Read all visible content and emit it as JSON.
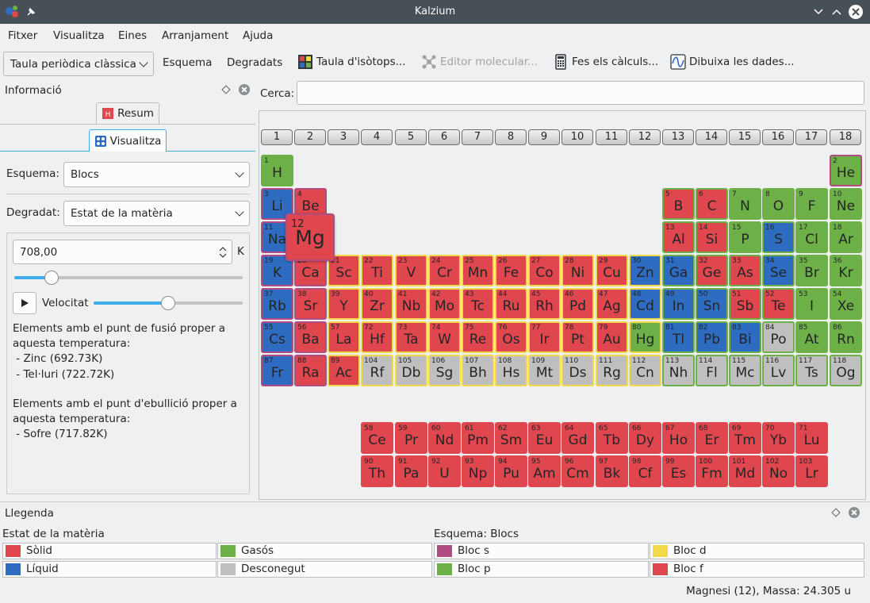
{
  "window": {
    "title": "Kalzium"
  },
  "menu": [
    "Fitxer",
    "Visualitza",
    "Eines",
    "Arranjament",
    "Ajuda"
  ],
  "toolbar": {
    "table_select": "Taula periòdica clàssica",
    "scheme": "Esquema",
    "gradients": "Degradats",
    "isotopes": "Taula d'isòtops...",
    "molecular_editor": "Editor molecular...",
    "calculations": "Fes els càlculs...",
    "plot_data": "Dibuixa les dades..."
  },
  "info_panel": {
    "title": "Informació",
    "tab_summary": "Resum",
    "tab_view": "Visualitza",
    "scheme_label": "Esquema:",
    "scheme_value": "Blocs",
    "gradient_label": "Degradat:",
    "gradient_value": "Estat de la matèria",
    "temperature_value": "708,00",
    "temperature_unit": "K",
    "temperature_slider_fraction": 0.14,
    "speed_label": "Velocitat",
    "speed_slider_fraction": 0.5,
    "melting_text": [
      "Elements amb el punt de fusió proper a",
      "aquesta temperatura:",
      " - Zinc (692.73K)",
      " - Tel·luri (722.72K)"
    ],
    "boiling_text": [
      "Elements amb el punt d'ebullició proper a",
      "aquesta temperatura:",
      " - Sofre (717.82K)"
    ]
  },
  "search": {
    "label": "Cerca:",
    "value": ""
  },
  "groups": [
    "1",
    "2",
    "3",
    "4",
    "5",
    "6",
    "7",
    "8",
    "9",
    "10",
    "11",
    "12",
    "13",
    "14",
    "15",
    "16",
    "17",
    "18"
  ],
  "colors": {
    "solid": "#e0464d",
    "liquid": "#2d6cc0",
    "gas": "#6eb048",
    "unknown": "#bfbfbf",
    "block_s": "#b24b82",
    "block_p": "#6eb048",
    "block_d": "#f1d94a",
    "block_f": "#e0464d"
  },
  "elements": [
    {
      "sym": "H",
      "num": 1,
      "p": 1,
      "g": 1,
      "st": "gas",
      "b": "p"
    },
    {
      "sym": "He",
      "num": 2,
      "p": 1,
      "g": 18,
      "st": "gas",
      "b": "s"
    },
    {
      "sym": "Li",
      "num": 3,
      "p": 2,
      "g": 1,
      "st": "liquid",
      "b": "s"
    },
    {
      "sym": "Be",
      "num": 4,
      "p": 2,
      "g": 2,
      "st": "solid",
      "b": "s"
    },
    {
      "sym": "B",
      "num": 5,
      "p": 2,
      "g": 13,
      "st": "solid",
      "b": "p"
    },
    {
      "sym": "C",
      "num": 6,
      "p": 2,
      "g": 14,
      "st": "solid",
      "b": "p"
    },
    {
      "sym": "N",
      "num": 7,
      "p": 2,
      "g": 15,
      "st": "gas",
      "b": "p"
    },
    {
      "sym": "O",
      "num": 8,
      "p": 2,
      "g": 16,
      "st": "gas",
      "b": "p"
    },
    {
      "sym": "F",
      "num": 9,
      "p": 2,
      "g": 17,
      "st": "gas",
      "b": "p"
    },
    {
      "sym": "Ne",
      "num": 10,
      "p": 2,
      "g": 18,
      "st": "gas",
      "b": "p"
    },
    {
      "sym": "Na",
      "num": 11,
      "p": 3,
      "g": 1,
      "st": "liquid",
      "b": "s"
    },
    {
      "sym": "Al",
      "num": 13,
      "p": 3,
      "g": 13,
      "st": "solid",
      "b": "p"
    },
    {
      "sym": "Si",
      "num": 14,
      "p": 3,
      "g": 14,
      "st": "solid",
      "b": "p"
    },
    {
      "sym": "P",
      "num": 15,
      "p": 3,
      "g": 15,
      "st": "gas",
      "b": "p"
    },
    {
      "sym": "S",
      "num": 16,
      "p": 3,
      "g": 16,
      "st": "liquid",
      "b": "p"
    },
    {
      "sym": "Cl",
      "num": 17,
      "p": 3,
      "g": 17,
      "st": "gas",
      "b": "p"
    },
    {
      "sym": "Ar",
      "num": 18,
      "p": 3,
      "g": 18,
      "st": "gas",
      "b": "p"
    },
    {
      "sym": "K",
      "num": 19,
      "p": 4,
      "g": 1,
      "st": "liquid",
      "b": "s"
    },
    {
      "sym": "Ca",
      "num": 20,
      "p": 4,
      "g": 2,
      "st": "solid",
      "b": "s"
    },
    {
      "sym": "Sc",
      "num": 21,
      "p": 4,
      "g": 3,
      "st": "solid",
      "b": "d"
    },
    {
      "sym": "Ti",
      "num": 22,
      "p": 4,
      "g": 4,
      "st": "solid",
      "b": "d"
    },
    {
      "sym": "V",
      "num": 23,
      "p": 4,
      "g": 5,
      "st": "solid",
      "b": "d"
    },
    {
      "sym": "Cr",
      "num": 24,
      "p": 4,
      "g": 6,
      "st": "solid",
      "b": "d"
    },
    {
      "sym": "Mn",
      "num": 25,
      "p": 4,
      "g": 7,
      "st": "solid",
      "b": "d"
    },
    {
      "sym": "Fe",
      "num": 26,
      "p": 4,
      "g": 8,
      "st": "solid",
      "b": "d"
    },
    {
      "sym": "Co",
      "num": 27,
      "p": 4,
      "g": 9,
      "st": "solid",
      "b": "d"
    },
    {
      "sym": "Ni",
      "num": 28,
      "p": 4,
      "g": 10,
      "st": "solid",
      "b": "d"
    },
    {
      "sym": "Cu",
      "num": 29,
      "p": 4,
      "g": 11,
      "st": "solid",
      "b": "d"
    },
    {
      "sym": "Zn",
      "num": 30,
      "p": 4,
      "g": 12,
      "st": "liquid",
      "b": "d"
    },
    {
      "sym": "Ga",
      "num": 31,
      "p": 4,
      "g": 13,
      "st": "liquid",
      "b": "p"
    },
    {
      "sym": "Ge",
      "num": 32,
      "p": 4,
      "g": 14,
      "st": "solid",
      "b": "p"
    },
    {
      "sym": "As",
      "num": 33,
      "p": 4,
      "g": 15,
      "st": "solid",
      "b": "p"
    },
    {
      "sym": "Se",
      "num": 34,
      "p": 4,
      "g": 16,
      "st": "liquid",
      "b": "p"
    },
    {
      "sym": "Br",
      "num": 35,
      "p": 4,
      "g": 17,
      "st": "gas",
      "b": "p"
    },
    {
      "sym": "Kr",
      "num": 36,
      "p": 4,
      "g": 18,
      "st": "gas",
      "b": "p"
    },
    {
      "sym": "Rb",
      "num": 37,
      "p": 5,
      "g": 1,
      "st": "liquid",
      "b": "s"
    },
    {
      "sym": "Sr",
      "num": 38,
      "p": 5,
      "g": 2,
      "st": "solid",
      "b": "s"
    },
    {
      "sym": "Y",
      "num": 39,
      "p": 5,
      "g": 3,
      "st": "solid",
      "b": "d"
    },
    {
      "sym": "Zr",
      "num": 40,
      "p": 5,
      "g": 4,
      "st": "solid",
      "b": "d"
    },
    {
      "sym": "Nb",
      "num": 41,
      "p": 5,
      "g": 5,
      "st": "solid",
      "b": "d"
    },
    {
      "sym": "Mo",
      "num": 42,
      "p": 5,
      "g": 6,
      "st": "solid",
      "b": "d"
    },
    {
      "sym": "Tc",
      "num": 43,
      "p": 5,
      "g": 7,
      "st": "solid",
      "b": "d"
    },
    {
      "sym": "Ru",
      "num": 44,
      "p": 5,
      "g": 8,
      "st": "solid",
      "b": "d"
    },
    {
      "sym": "Rh",
      "num": 45,
      "p": 5,
      "g": 9,
      "st": "solid",
      "b": "d"
    },
    {
      "sym": "Pd",
      "num": 46,
      "p": 5,
      "g": 10,
      "st": "solid",
      "b": "d"
    },
    {
      "sym": "Ag",
      "num": 47,
      "p": 5,
      "g": 11,
      "st": "solid",
      "b": "d"
    },
    {
      "sym": "Cd",
      "num": 48,
      "p": 5,
      "g": 12,
      "st": "liquid",
      "b": "d"
    },
    {
      "sym": "In",
      "num": 49,
      "p": 5,
      "g": 13,
      "st": "liquid",
      "b": "p"
    },
    {
      "sym": "Sn",
      "num": 50,
      "p": 5,
      "g": 14,
      "st": "liquid",
      "b": "p"
    },
    {
      "sym": "Sb",
      "num": 51,
      "p": 5,
      "g": 15,
      "st": "solid",
      "b": "p"
    },
    {
      "sym": "Te",
      "num": 52,
      "p": 5,
      "g": 16,
      "st": "solid",
      "b": "p"
    },
    {
      "sym": "I",
      "num": 53,
      "p": 5,
      "g": 17,
      "st": "gas",
      "b": "p"
    },
    {
      "sym": "Xe",
      "num": 54,
      "p": 5,
      "g": 18,
      "st": "gas",
      "b": "p"
    },
    {
      "sym": "Cs",
      "num": 55,
      "p": 6,
      "g": 1,
      "st": "liquid",
      "b": "s"
    },
    {
      "sym": "Ba",
      "num": 56,
      "p": 6,
      "g": 2,
      "st": "solid",
      "b": "s"
    },
    {
      "sym": "La",
      "num": 57,
      "p": 6,
      "g": 3,
      "st": "solid",
      "b": "d"
    },
    {
      "sym": "Hf",
      "num": 72,
      "p": 6,
      "g": 4,
      "st": "solid",
      "b": "d"
    },
    {
      "sym": "Ta",
      "num": 73,
      "p": 6,
      "g": 5,
      "st": "solid",
      "b": "d"
    },
    {
      "sym": "W",
      "num": 74,
      "p": 6,
      "g": 6,
      "st": "solid",
      "b": "d"
    },
    {
      "sym": "Re",
      "num": 75,
      "p": 6,
      "g": 7,
      "st": "solid",
      "b": "d"
    },
    {
      "sym": "Os",
      "num": 76,
      "p": 6,
      "g": 8,
      "st": "solid",
      "b": "d"
    },
    {
      "sym": "Ir",
      "num": 77,
      "p": 6,
      "g": 9,
      "st": "solid",
      "b": "d"
    },
    {
      "sym": "Pt",
      "num": 78,
      "p": 6,
      "g": 10,
      "st": "solid",
      "b": "d"
    },
    {
      "sym": "Au",
      "num": 79,
      "p": 6,
      "g": 11,
      "st": "solid",
      "b": "d"
    },
    {
      "sym": "Hg",
      "num": 80,
      "p": 6,
      "g": 12,
      "st": "gas",
      "b": "d"
    },
    {
      "sym": "Tl",
      "num": 81,
      "p": 6,
      "g": 13,
      "st": "liquid",
      "b": "p"
    },
    {
      "sym": "Pb",
      "num": 82,
      "p": 6,
      "g": 14,
      "st": "liquid",
      "b": "p"
    },
    {
      "sym": "Bi",
      "num": 83,
      "p": 6,
      "g": 15,
      "st": "liquid",
      "b": "p"
    },
    {
      "sym": "Po",
      "num": 84,
      "p": 6,
      "g": 16,
      "st": "unknown",
      "b": "p"
    },
    {
      "sym": "At",
      "num": 85,
      "p": 6,
      "g": 17,
      "st": "gas",
      "b": "p"
    },
    {
      "sym": "Rn",
      "num": 86,
      "p": 6,
      "g": 18,
      "st": "gas",
      "b": "p"
    },
    {
      "sym": "Fr",
      "num": 87,
      "p": 7,
      "g": 1,
      "st": "liquid",
      "b": "s"
    },
    {
      "sym": "Ra",
      "num": 88,
      "p": 7,
      "g": 2,
      "st": "solid",
      "b": "s"
    },
    {
      "sym": "Ac",
      "num": 89,
      "p": 7,
      "g": 3,
      "st": "solid",
      "b": "d"
    },
    {
      "sym": "Rf",
      "num": 104,
      "p": 7,
      "g": 4,
      "st": "unknown",
      "b": "d"
    },
    {
      "sym": "Db",
      "num": 105,
      "p": 7,
      "g": 5,
      "st": "unknown",
      "b": "d"
    },
    {
      "sym": "Sg",
      "num": 106,
      "p": 7,
      "g": 6,
      "st": "unknown",
      "b": "d"
    },
    {
      "sym": "Bh",
      "num": 107,
      "p": 7,
      "g": 7,
      "st": "unknown",
      "b": "d"
    },
    {
      "sym": "Hs",
      "num": 108,
      "p": 7,
      "g": 8,
      "st": "unknown",
      "b": "d"
    },
    {
      "sym": "Mt",
      "num": 109,
      "p": 7,
      "g": 9,
      "st": "unknown",
      "b": "d"
    },
    {
      "sym": "Ds",
      "num": 110,
      "p": 7,
      "g": 10,
      "st": "unknown",
      "b": "d"
    },
    {
      "sym": "Rg",
      "num": 111,
      "p": 7,
      "g": 11,
      "st": "unknown",
      "b": "d"
    },
    {
      "sym": "Cn",
      "num": 112,
      "p": 7,
      "g": 12,
      "st": "unknown",
      "b": "d"
    },
    {
      "sym": "Nh",
      "num": 113,
      "p": 7,
      "g": 13,
      "st": "unknown",
      "b": "p"
    },
    {
      "sym": "Fl",
      "num": 114,
      "p": 7,
      "g": 14,
      "st": "unknown",
      "b": "p"
    },
    {
      "sym": "Mc",
      "num": 115,
      "p": 7,
      "g": 15,
      "st": "unknown",
      "b": "p"
    },
    {
      "sym": "Lv",
      "num": 116,
      "p": 7,
      "g": 16,
      "st": "unknown",
      "b": "p"
    },
    {
      "sym": "Ts",
      "num": 117,
      "p": 7,
      "g": 17,
      "st": "unknown",
      "b": "p"
    },
    {
      "sym": "Og",
      "num": 118,
      "p": 7,
      "g": 18,
      "st": "unknown",
      "b": "p"
    },
    {
      "sym": "Ce",
      "num": 58,
      "p": 9,
      "g": 4,
      "st": "solid",
      "b": "f"
    },
    {
      "sym": "Pr",
      "num": 59,
      "p": 9,
      "g": 5,
      "st": "solid",
      "b": "f"
    },
    {
      "sym": "Nd",
      "num": 60,
      "p": 9,
      "g": 6,
      "st": "solid",
      "b": "f"
    },
    {
      "sym": "Pm",
      "num": 61,
      "p": 9,
      "g": 7,
      "st": "solid",
      "b": "f"
    },
    {
      "sym": "Sm",
      "num": 62,
      "p": 9,
      "g": 8,
      "st": "solid",
      "b": "f"
    },
    {
      "sym": "Eu",
      "num": 63,
      "p": 9,
      "g": 9,
      "st": "solid",
      "b": "f"
    },
    {
      "sym": "Gd",
      "num": 64,
      "p": 9,
      "g": 10,
      "st": "solid",
      "b": "f"
    },
    {
      "sym": "Tb",
      "num": 65,
      "p": 9,
      "g": 11,
      "st": "solid",
      "b": "f"
    },
    {
      "sym": "Dy",
      "num": 66,
      "p": 9,
      "g": 12,
      "st": "solid",
      "b": "f"
    },
    {
      "sym": "Ho",
      "num": 67,
      "p": 9,
      "g": 13,
      "st": "solid",
      "b": "f"
    },
    {
      "sym": "Er",
      "num": 68,
      "p": 9,
      "g": 14,
      "st": "solid",
      "b": "f"
    },
    {
      "sym": "Tm",
      "num": 69,
      "p": 9,
      "g": 15,
      "st": "solid",
      "b": "f"
    },
    {
      "sym": "Yb",
      "num": 70,
      "p": 9,
      "g": 16,
      "st": "solid",
      "b": "f"
    },
    {
      "sym": "Lu",
      "num": 71,
      "p": 9,
      "g": 17,
      "st": "solid",
      "b": "f"
    },
    {
      "sym": "Th",
      "num": 90,
      "p": 10,
      "g": 4,
      "st": "solid",
      "b": "f"
    },
    {
      "sym": "Pa",
      "num": 91,
      "p": 10,
      "g": 5,
      "st": "solid",
      "b": "f"
    },
    {
      "sym": "U",
      "num": 92,
      "p": 10,
      "g": 6,
      "st": "solid",
      "b": "f"
    },
    {
      "sym": "Np",
      "num": 93,
      "p": 10,
      "g": 7,
      "st": "solid",
      "b": "f"
    },
    {
      "sym": "Pu",
      "num": 94,
      "p": 10,
      "g": 8,
      "st": "solid",
      "b": "f"
    },
    {
      "sym": "Am",
      "num": 95,
      "p": 10,
      "g": 9,
      "st": "solid",
      "b": "f"
    },
    {
      "sym": "Cm",
      "num": 96,
      "p": 10,
      "g": 10,
      "st": "solid",
      "b": "f"
    },
    {
      "sym": "Bk",
      "num": 97,
      "p": 10,
      "g": 11,
      "st": "solid",
      "b": "f"
    },
    {
      "sym": "Cf",
      "num": 98,
      "p": 10,
      "g": 12,
      "st": "solid",
      "b": "f"
    },
    {
      "sym": "Es",
      "num": 99,
      "p": 10,
      "g": 13,
      "st": "solid",
      "b": "f"
    },
    {
      "sym": "Fm",
      "num": 100,
      "p": 10,
      "g": 14,
      "st": "solid",
      "b": "f"
    },
    {
      "sym": "Md",
      "num": 101,
      "p": 10,
      "g": 15,
      "st": "solid",
      "b": "f"
    },
    {
      "sym": "No",
      "num": 102,
      "p": 10,
      "g": 16,
      "st": "solid",
      "b": "f"
    },
    {
      "sym": "Lr",
      "num": 103,
      "p": 10,
      "g": 17,
      "st": "solid",
      "b": "f"
    }
  ],
  "highlighted": {
    "sym": "Mg",
    "num": "12"
  },
  "legend": {
    "title": "Llegenda",
    "state_title": "Estat de la matèria",
    "scheme_title": "Esquema: Blocs",
    "solid": "Sòlid",
    "gas": "Gasós",
    "liquid": "Líquid",
    "unknown": "Desconegut",
    "block_s": "Bloc s",
    "block_d": "Bloc d",
    "block_p": "Bloc p",
    "block_f": "Bloc f"
  },
  "status": "Magnesi (12), Massa: 24.305 u"
}
